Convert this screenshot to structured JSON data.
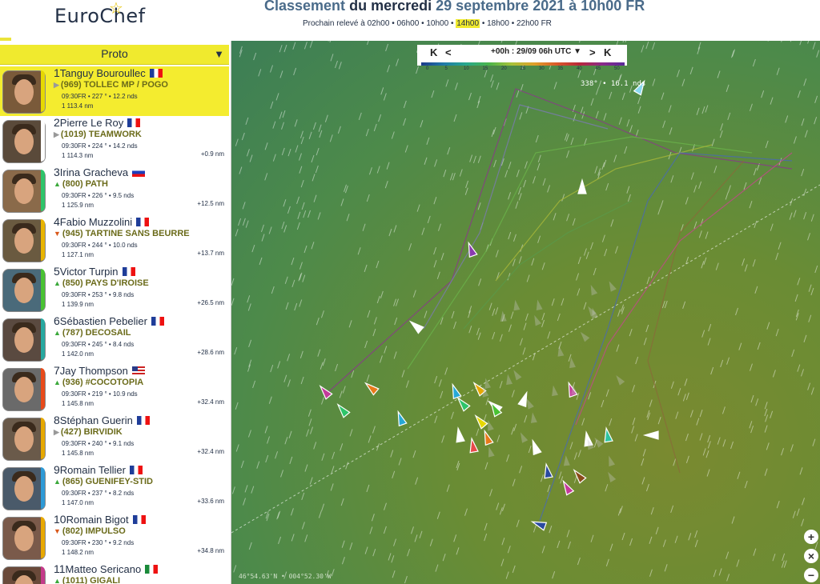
{
  "header": {
    "logo": "EuroChef",
    "title_a": "Classement",
    "title_b": "du mercredi",
    "title_c": "29 septembre 2021 à 10h00 FR",
    "next_label": "Prochain relevé à",
    "times": [
      "02h00",
      "06h00",
      "10h00",
      "14h00",
      "18h00",
      "22h00"
    ],
    "selected_time": "14h00",
    "tz": "FR"
  },
  "class_select": {
    "label": "Proto"
  },
  "leaderboard": [
    {
      "rank": "1",
      "name": "Tanguy Bouroullec",
      "flag": "fr",
      "trend": "none",
      "boat": "(969) TOLLEC MP / POGO",
      "stats": "09:30FR • 227 ° • 12.2 nds",
      "dist": "1 113.4 nm",
      "gap": "",
      "color": "#e6d800"
    },
    {
      "rank": "2",
      "name": "Pierre Le Roy",
      "flag": "fr",
      "trend": "none",
      "boat": "(1019) TEAMWORK",
      "stats": "09:30FR • 224 ° • 14.2 nds",
      "dist": "1 114.3 nm",
      "gap": "+0.9 nm",
      "color": "#ffffff"
    },
    {
      "rank": "3",
      "name": "Irina Gracheva",
      "flag": "ru",
      "trend": "up",
      "boat": "(800) PATH",
      "stats": "09:30FR • 226 ° • 9.5 nds",
      "dist": "1 125.9 nm",
      "gap": "+12.5 nm",
      "color": "#2ec46a"
    },
    {
      "rank": "4",
      "name": "Fabio Muzzolini",
      "flag": "fr",
      "trend": "down",
      "boat": "(945) TARTINE SANS BEURRE",
      "stats": "09:30FR • 244 ° • 10.0 nds",
      "dist": "1 127.1 nm",
      "gap": "+13.7 nm",
      "color": "#e8b400"
    },
    {
      "rank": "5",
      "name": "Victor Turpin",
      "flag": "fr",
      "trend": "up",
      "boat": "(850) PAYS D'IROISE",
      "stats": "09:30FR • 253 ° • 9.8 nds",
      "dist": "1 139.9 nm",
      "gap": "+26.5 nm",
      "color": "#49c233"
    },
    {
      "rank": "6",
      "name": "Sébastien Pebelier",
      "flag": "fr",
      "trend": "up",
      "boat": "(787) DECOSAIL",
      "stats": "09:30FR • 245 ° • 8.4 nds",
      "dist": "1 142.0 nm",
      "gap": "+28.6 nm",
      "color": "#27a8a0"
    },
    {
      "rank": "7",
      "name": "Jay Thompson",
      "flag": "us",
      "trend": "up",
      "boat": "(936) #COCOTOPIA",
      "stats": "09:30FR • 219 ° • 10.9 nds",
      "dist": "1 145.8 nm",
      "gap": "+32.4 nm",
      "color": "#e84a1a"
    },
    {
      "rank": "8",
      "name": "Stéphan Guerin",
      "flag": "fr",
      "trend": "none",
      "boat": "(427) BIRVIDIK",
      "stats": "09:30FR • 240 ° • 9.1 nds",
      "dist": "1 145.8 nm",
      "gap": "+32.4 nm",
      "color": "#e6a800"
    },
    {
      "rank": "9",
      "name": "Romain Tellier",
      "flag": "fr",
      "trend": "up",
      "boat": "(865) GUENIFEY-STID",
      "stats": "09:30FR • 237 ° • 8.2 nds",
      "dist": "1 147.0 nm",
      "gap": "+33.6 nm",
      "color": "#2e9ad6"
    },
    {
      "rank": "10",
      "name": "Romain Bigot",
      "flag": "fr",
      "trend": "down",
      "boat": "(802) IMPULSO",
      "stats": "09:30FR • 230 ° • 9.2 nds",
      "dist": "1 148.2 nm",
      "gap": "+34.8 nm",
      "color": "#e8a800"
    },
    {
      "rank": "11",
      "name": "Matteo Sericano",
      "flag": "it",
      "trend": "up",
      "boat": "(1011) GIGALI",
      "stats": "",
      "dist": "",
      "gap": "",
      "color": "#c43a8a"
    }
  ],
  "timeline": {
    "time": "+00h : 29/09 06h UTC",
    "first": "first-icon",
    "prev": "prev-icon",
    "next": "next-icon",
    "last": "last-icon"
  },
  "wind_scale": [
    "0",
    "5",
    "10",
    "15",
    "20",
    "25",
    "30",
    "35",
    "40",
    "45",
    "50"
  ],
  "wind_readout": "338° • 16.1 nds",
  "coords": "46°54.63'N • 004°52.30'W",
  "zoom": {
    "in": "+",
    "reset": "×",
    "out": "−"
  }
}
